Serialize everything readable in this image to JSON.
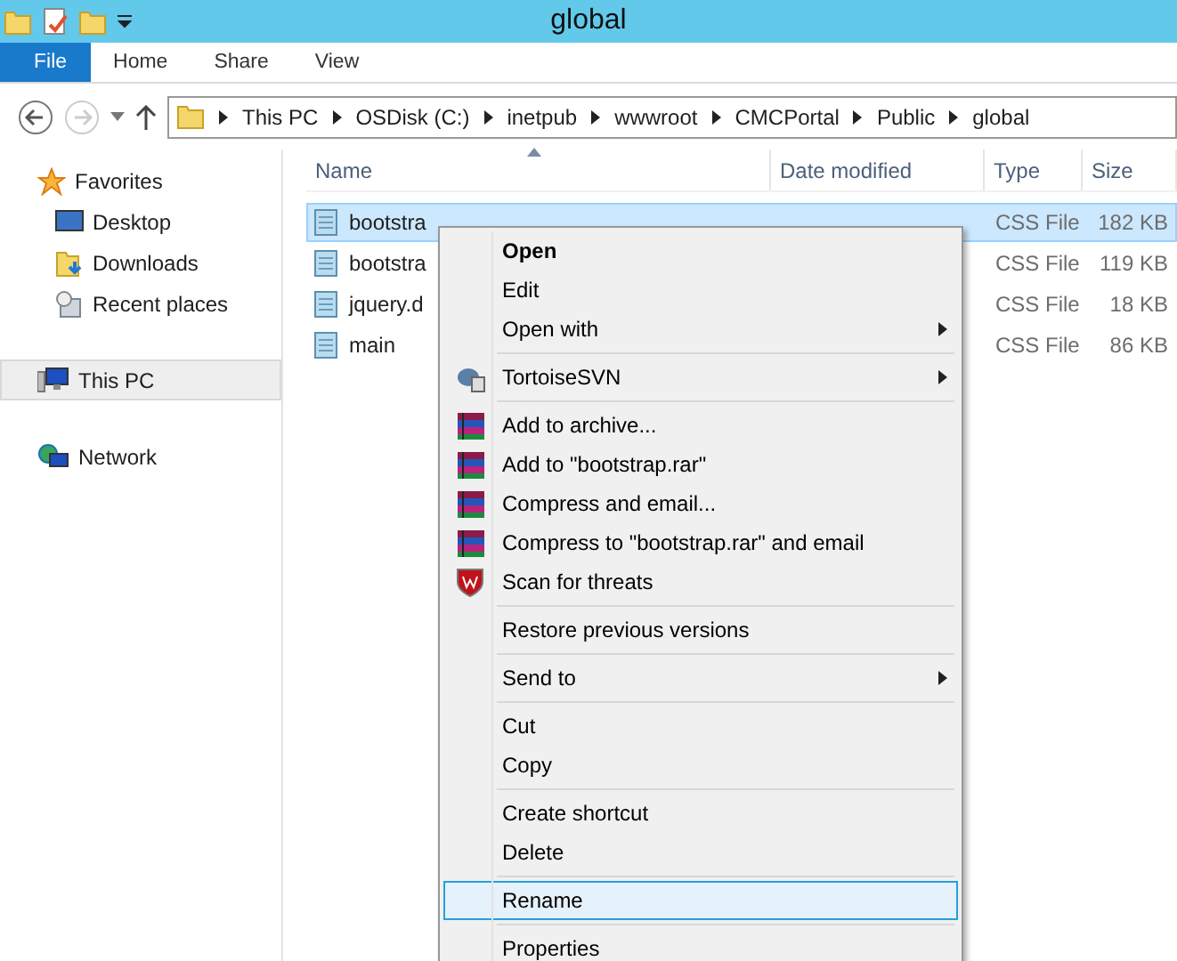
{
  "window": {
    "title": "global"
  },
  "ribbon_tabs": [
    {
      "label": "File",
      "selected": true
    },
    {
      "label": "Home",
      "selected": false
    },
    {
      "label": "Share",
      "selected": false
    },
    {
      "label": "View",
      "selected": false
    }
  ],
  "breadcrumb": [
    "This PC",
    "OSDisk (C:)",
    "inetpub",
    "wwwroot",
    "CMCPortal",
    "Public",
    "global"
  ],
  "sidebar": {
    "groups": [
      {
        "label": "Favorites",
        "kind": "star",
        "selected": false,
        "children": [
          {
            "label": "Desktop",
            "kind": "desktop",
            "selected": false
          },
          {
            "label": "Downloads",
            "kind": "downloads",
            "selected": false
          },
          {
            "label": "Recent places",
            "kind": "recent",
            "selected": false
          }
        ]
      },
      {
        "label": "This PC",
        "kind": "pc",
        "selected": true
      },
      {
        "label": "Network",
        "kind": "network",
        "selected": false
      }
    ]
  },
  "table": {
    "columns": [
      "Name",
      "Date modified",
      "Type",
      "Size"
    ],
    "rows": [
      {
        "name": "bootstra",
        "type": "CSS File",
        "size": "182 KB",
        "selected": true
      },
      {
        "name": "bootstra",
        "type": "CSS File",
        "size": "119 KB",
        "selected": false
      },
      {
        "name": "jquery.d",
        "type": "CSS File",
        "size": "18 KB",
        "selected": false
      },
      {
        "name": "main",
        "type": "CSS File",
        "size": "86 KB",
        "selected": false
      }
    ]
  },
  "context_menu": [
    {
      "kind": "item",
      "label": "Open",
      "default": true,
      "submenu": false,
      "selected": false
    },
    {
      "kind": "item",
      "label": "Edit",
      "default": false,
      "submenu": false,
      "selected": false
    },
    {
      "kind": "item",
      "label": "Open with",
      "default": false,
      "submenu": true,
      "selected": false
    },
    {
      "kind": "separator"
    },
    {
      "kind": "svn",
      "label": "TortoiseSVN",
      "default": false,
      "submenu": true,
      "selected": false
    },
    {
      "kind": "separator"
    },
    {
      "kind": "archive",
      "label": "Add to archive...",
      "default": false,
      "submenu": false,
      "selected": false
    },
    {
      "kind": "archive",
      "label": "Add to \"bootstrap.rar\"",
      "default": false,
      "submenu": false,
      "selected": false
    },
    {
      "kind": "archive",
      "label": "Compress and email...",
      "default": false,
      "submenu": false,
      "selected": false
    },
    {
      "kind": "archive",
      "label": "Compress to \"bootstrap.rar\" and email",
      "default": false,
      "submenu": false,
      "selected": false
    },
    {
      "kind": "shield",
      "label": "Scan for threats",
      "default": false,
      "submenu": false,
      "selected": false
    },
    {
      "kind": "separator"
    },
    {
      "kind": "item",
      "label": "Restore previous versions",
      "default": false,
      "submenu": false,
      "selected": false
    },
    {
      "kind": "separator"
    },
    {
      "kind": "item",
      "label": "Send to",
      "default": false,
      "submenu": true,
      "selected": false
    },
    {
      "kind": "separator"
    },
    {
      "kind": "item",
      "label": "Cut",
      "default": false,
      "submenu": false,
      "selected": false
    },
    {
      "kind": "item",
      "label": "Copy",
      "default": false,
      "submenu": false,
      "selected": false
    },
    {
      "kind": "separator"
    },
    {
      "kind": "item",
      "label": "Create shortcut",
      "default": false,
      "submenu": false,
      "selected": false
    },
    {
      "kind": "item",
      "label": "Delete",
      "default": false,
      "submenu": false,
      "selected": false
    },
    {
      "kind": "separator"
    },
    {
      "kind": "item",
      "label": "Rename",
      "default": false,
      "submenu": false,
      "selected": true
    },
    {
      "kind": "separator"
    },
    {
      "kind": "item",
      "label": "Properties",
      "default": false,
      "submenu": false,
      "selected": false
    }
  ]
}
